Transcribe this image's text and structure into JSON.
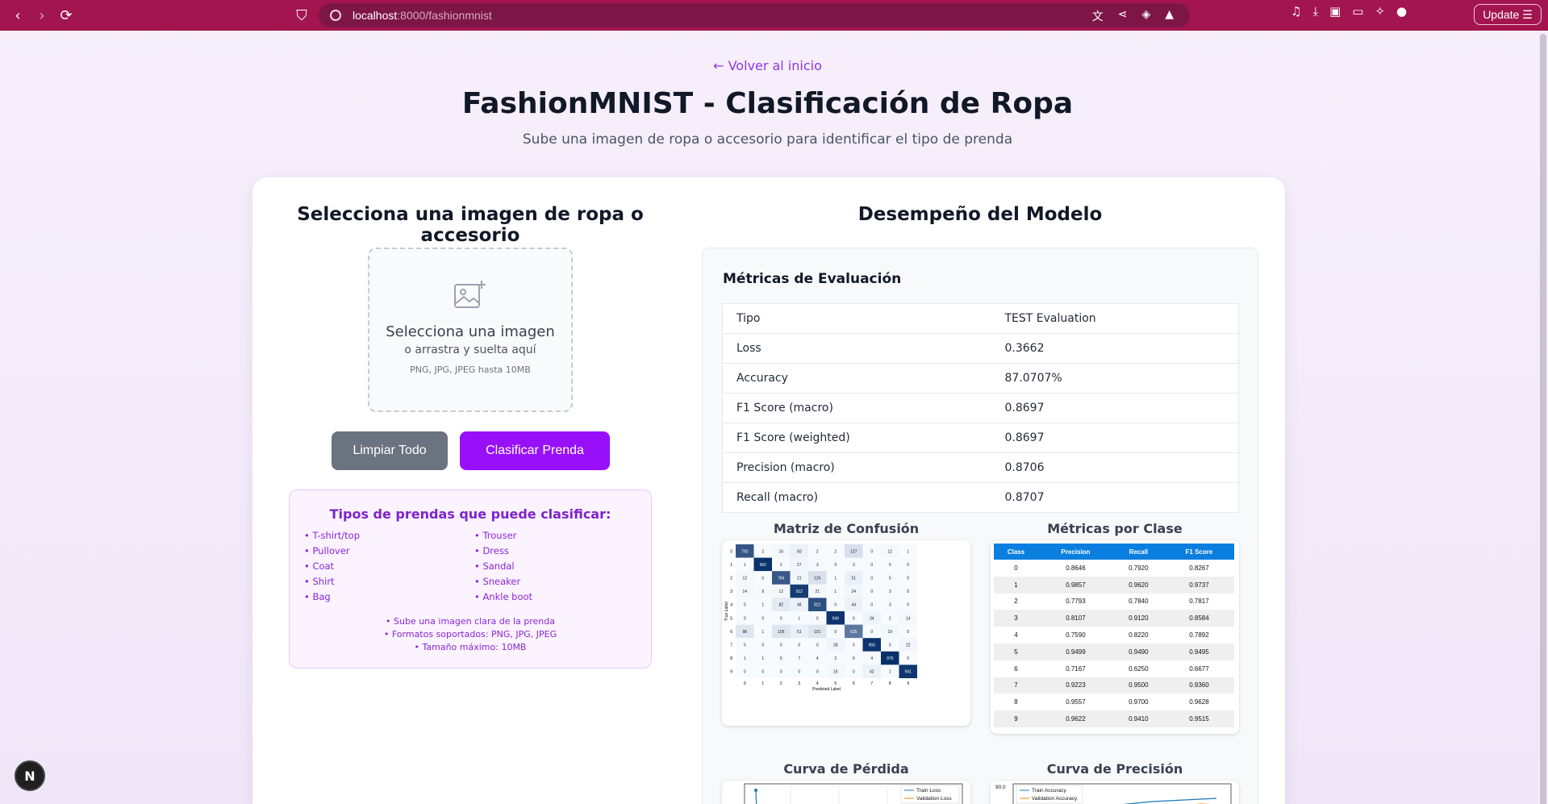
{
  "browser": {
    "url_host": "localhost",
    "url_path": ":8000/fashionmnist",
    "update_label": "Update"
  },
  "header": {
    "back_link": "← Volver al inicio",
    "title": "FashionMNIST - Clasificación de Ropa",
    "subtitle": "Sube una imagen de ropa o accesorio para identificar el tipo de prenda"
  },
  "upload": {
    "title": "Selecciona una imagen de ropa o accesorio",
    "main": "Selecciona una imagen",
    "sub": "o arrastra y suelta aquí",
    "hint": "PNG, JPG, JPEG hasta 10MB",
    "clear_label": "Limpiar Todo",
    "classify_label": "Clasificar Prenda"
  },
  "types": {
    "title": "Tipos de prendas que puede clasificar:",
    "items": [
      "• T-shirt/top",
      "• Trouser",
      "• Pullover",
      "• Dress",
      "• Coat",
      "• Sandal",
      "• Shirt",
      "• Sneaker",
      "• Bag",
      "• Ankle boot"
    ],
    "notes": [
      "• Sube una imagen clara de la prenda",
      "• Formatos soportados: PNG, JPG, JPEG",
      "• Tamaño máximo: 10MB"
    ]
  },
  "model": {
    "title": "Desempeño del Modelo",
    "metrics_heading": "Métricas de Evaluación",
    "metrics": [
      {
        "label": "Tipo",
        "value": "TEST Evaluation"
      },
      {
        "label": "Loss",
        "value": "0.3662"
      },
      {
        "label": "Accuracy",
        "value": "87.0707%"
      },
      {
        "label": "F1 Score (macro)",
        "value": "0.8697"
      },
      {
        "label": "F1 Score (weighted)",
        "value": "0.8697"
      },
      {
        "label": "Precision (macro)",
        "value": "0.8706"
      },
      {
        "label": "Recall (macro)",
        "value": "0.8707"
      }
    ],
    "confusion_title": "Matriz de Confusión",
    "per_class_title": "Métricas por Clase",
    "loss_title": "Curva de Pérdida",
    "acc_title": "Curva de Precisión"
  },
  "confusion": {
    "matrix": [
      [
        792,
        2,
        16,
        50,
        2,
        2,
        127,
        0,
        12,
        1
      ],
      [
        1,
        962,
        2,
        27,
        3,
        0,
        3,
        0,
        0,
        0
      ],
      [
        12,
        0,
        784,
        21,
        126,
        1,
        51,
        0,
        5,
        0
      ],
      [
        14,
        9,
        12,
        912,
        21,
        1,
        24,
        0,
        3,
        0
      ],
      [
        0,
        1,
        82,
        48,
        822,
        0,
        44,
        0,
        3,
        0
      ],
      [
        0,
        0,
        0,
        1,
        0,
        949,
        0,
        34,
        2,
        14
      ],
      [
        98,
        1,
        105,
        51,
        101,
        0,
        625,
        0,
        19,
        0
      ],
      [
        0,
        0,
        0,
        0,
        0,
        28,
        0,
        950,
        0,
        22
      ],
      [
        1,
        1,
        5,
        7,
        4,
        2,
        6,
        4,
        970,
        0
      ],
      [
        0,
        0,
        0,
        0,
        0,
        16,
        0,
        42,
        1,
        941
      ]
    ],
    "xlabel": "Predicted Label",
    "ylabel": "True Label",
    "ticks": [
      "0",
      "1",
      "2",
      "3",
      "4",
      "5",
      "6",
      "7",
      "8",
      "9"
    ]
  },
  "per_class": {
    "headers": [
      "Class",
      "Precision",
      "Recall",
      "F1 Score"
    ],
    "rows": [
      [
        "0",
        "0.8646",
        "0.7920",
        "0.8267"
      ],
      [
        "1",
        "0.9857",
        "0.9620",
        "0.9737"
      ],
      [
        "2",
        "0.7793",
        "0.7840",
        "0.7817"
      ],
      [
        "3",
        "0.8107",
        "0.9120",
        "0.8584"
      ],
      [
        "4",
        "0.7590",
        "0.8220",
        "0.7892"
      ],
      [
        "5",
        "0.9499",
        "0.9490",
        "0.9495"
      ],
      [
        "6",
        "0.7167",
        "0.6250",
        "0.6677"
      ],
      [
        "7",
        "0.9223",
        "0.9500",
        "0.9360"
      ],
      [
        "8",
        "0.9557",
        "0.9700",
        "0.9628"
      ],
      [
        "9",
        "0.9622",
        "0.9410",
        "0.9515"
      ]
    ]
  },
  "loss_legend": [
    "Train Loss",
    "Validation Loss"
  ],
  "acc_legend": [
    "Train Accuracy",
    "Validation Accuracy"
  ],
  "acc_ytick": "90.0"
}
